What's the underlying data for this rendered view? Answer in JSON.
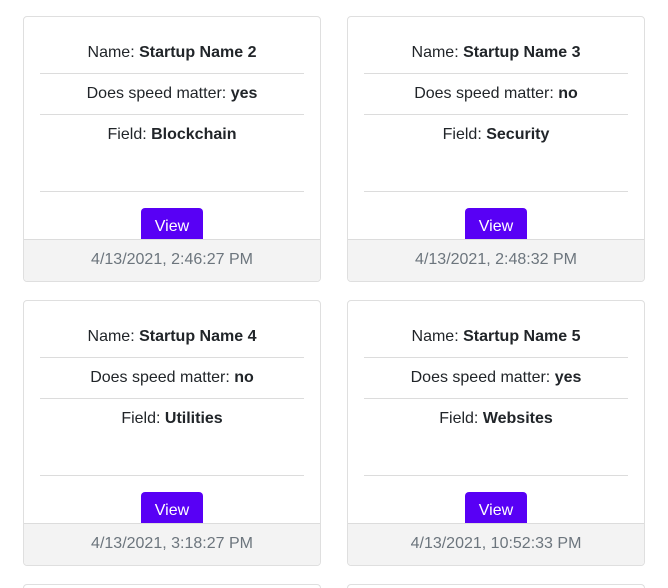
{
  "labels": {
    "name": "Name:",
    "speed": "Does speed matter:",
    "field": "Field:",
    "view_button": "View"
  },
  "cards": [
    {
      "name": "Startup Name 2",
      "speed": "yes",
      "field": "Blockchain",
      "timestamp": "4/13/2021, 2:46:27 PM"
    },
    {
      "name": "Startup Name 3",
      "speed": "no",
      "field": "Security",
      "timestamp": "4/13/2021, 2:48:32 PM"
    },
    {
      "name": "Startup Name 4",
      "speed": "no",
      "field": "Utilities",
      "timestamp": "4/13/2021, 3:18:27 PM"
    },
    {
      "name": "Startup Name 5",
      "speed": "yes",
      "field": "Websites",
      "timestamp": "4/13/2021, 10:52:33 PM"
    }
  ]
}
